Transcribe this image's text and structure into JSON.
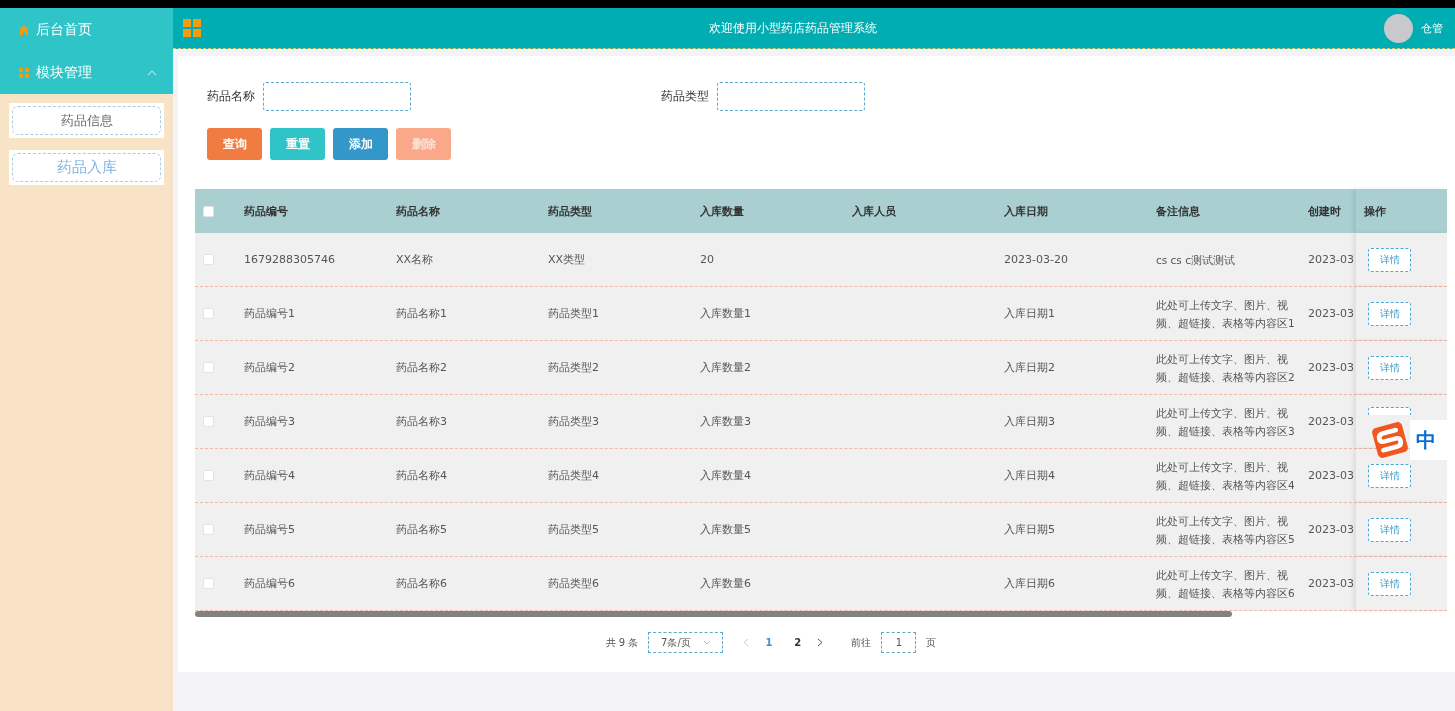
{
  "sidebar": {
    "items": [
      {
        "label": "后台首页"
      },
      {
        "label": "模块管理",
        "expanded": true,
        "children": [
          {
            "label": "药品信息",
            "selected": false
          },
          {
            "label": "药品入库",
            "selected": true
          }
        ]
      }
    ]
  },
  "header": {
    "title": "欢迎使用小型药店药品管理系统",
    "user": "仓管"
  },
  "search": {
    "fields": [
      {
        "label": "药品名称"
      },
      {
        "label": "药品类型"
      }
    ],
    "buttons": [
      {
        "label": "查询",
        "color": "#f07c41",
        "disabled": false
      },
      {
        "label": "重置",
        "color": "#2ec4c8",
        "disabled": false
      },
      {
        "label": "添加",
        "color": "#3497c9",
        "disabled": false
      },
      {
        "label": "删除",
        "color": "#f9a98a",
        "disabled": true
      }
    ]
  },
  "table": {
    "select_all_checked": false,
    "columns": [
      "药品编号",
      "药品名称",
      "药品类型",
      "入库数量",
      "入库人员",
      "入库日期",
      "备注信息",
      "创建时",
      "操作"
    ],
    "rows": [
      {
        "checked": false,
        "code": "1679288305746",
        "name": "XX名称",
        "type": "XX类型",
        "quantity": "20",
        "date": "2023-03-20",
        "note": "cs cs c测试测试",
        "created": "2023-03",
        "action": "详情"
      },
      {
        "checked": false,
        "code": "药品编号1",
        "name": "药品名称1",
        "type": "药品类型1",
        "quantity": "入库数量1",
        "date": "入库日期1",
        "note": "此处可上传文字、图片、视频、超链接、表格等内容区1",
        "created": "2023-03",
        "action": "详情"
      },
      {
        "checked": false,
        "code": "药品编号2",
        "name": "药品名称2",
        "type": "药品类型2",
        "quantity": "入库数量2",
        "date": "入库日期2",
        "note": "此处可上传文字、图片、视频、超链接、表格等内容区2",
        "created": "2023-03",
        "action": "详情"
      },
      {
        "checked": false,
        "code": "药品编号3",
        "name": "药品名称3",
        "type": "药品类型3",
        "quantity": "入库数量3",
        "date": "入库日期3",
        "note": "此处可上传文字、图片、视频、超链接、表格等内容区3",
        "created": "2023-03"
      },
      {
        "checked": false,
        "code": "药品编号4",
        "name": "药品名称4",
        "type": "药品类型4",
        "quantity": "入库数量4",
        "date": "入库日期4",
        "note": "此处可上传文字、图片、视频、超链接、表格等内容区4",
        "created": "2023-03",
        "action": "详情"
      },
      {
        "checked": false,
        "code": "药品编号5",
        "name": "药品名称5",
        "type": "药品类型5",
        "quantity": "入库数量5",
        "date": "入库日期5",
        "note": "此处可上传文字、图片、视频、超链接、表格等内容区5",
        "created": "2023-03",
        "action": "详情"
      },
      {
        "checked": false,
        "code": "药品编号6",
        "name": "药品名称6",
        "type": "药品类型6",
        "quantity": "入库数量6",
        "date": "入库日期6",
        "note": "此处可上传文字、图片、视频、超链接、表格等内容区6",
        "created": "2023-03",
        "action": "详情"
      }
    ]
  },
  "pagination": {
    "total": "共 9 条",
    "page_size": "7条/页",
    "pages": [
      {
        "label": "1",
        "selected": true
      },
      {
        "label": "2",
        "selected": false
      }
    ],
    "goto_label": "前往",
    "goto_value": "1",
    "goto_suffix": "页"
  },
  "ime": {
    "mode": "中"
  }
}
